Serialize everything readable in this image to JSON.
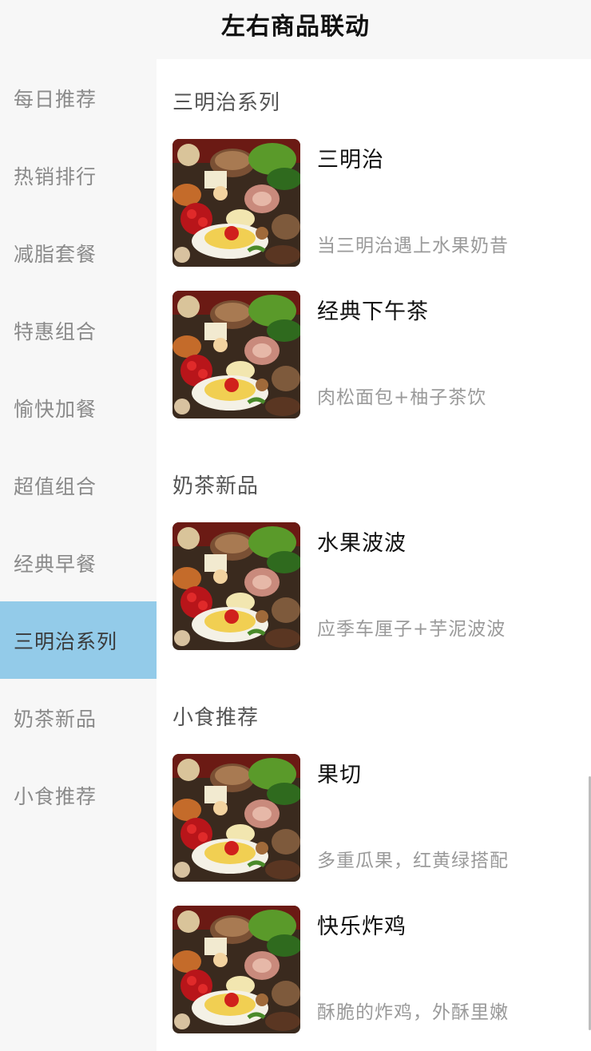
{
  "header": {
    "title": "左右商品联动"
  },
  "sidebar": {
    "items": [
      {
        "label": "每日推荐"
      },
      {
        "label": "热销排行"
      },
      {
        "label": "减脂套餐"
      },
      {
        "label": "特惠组合"
      },
      {
        "label": "愉快加餐"
      },
      {
        "label": "超值组合"
      },
      {
        "label": "经典早餐"
      },
      {
        "label": "三明治系列"
      },
      {
        "label": "奶茶新品"
      },
      {
        "label": "小食推荐"
      }
    ],
    "active_index": 7
  },
  "content": {
    "sections": [
      {
        "title": "三明治系列",
        "products": [
          {
            "name": "三明治",
            "desc": "当三明治遇上水果奶昔"
          },
          {
            "name": "经典下午茶",
            "desc": "肉松面包+柚子茶饮"
          }
        ]
      },
      {
        "title": "奶茶新品",
        "products": [
          {
            "name": "水果波波",
            "desc": "应季车厘子+芋泥波波"
          }
        ]
      },
      {
        "title": "小食推荐",
        "products": [
          {
            "name": "果切",
            "desc": "多重瓜果，红黄绿搭配"
          },
          {
            "name": "快乐炸鸡",
            "desc": "酥脆的炸鸡，外酥里嫩"
          }
        ]
      }
    ]
  },
  "colors": {
    "active_bg": "#93cbe9",
    "sidebar_bg": "#f7f7f7",
    "content_bg": "#ffffff"
  }
}
